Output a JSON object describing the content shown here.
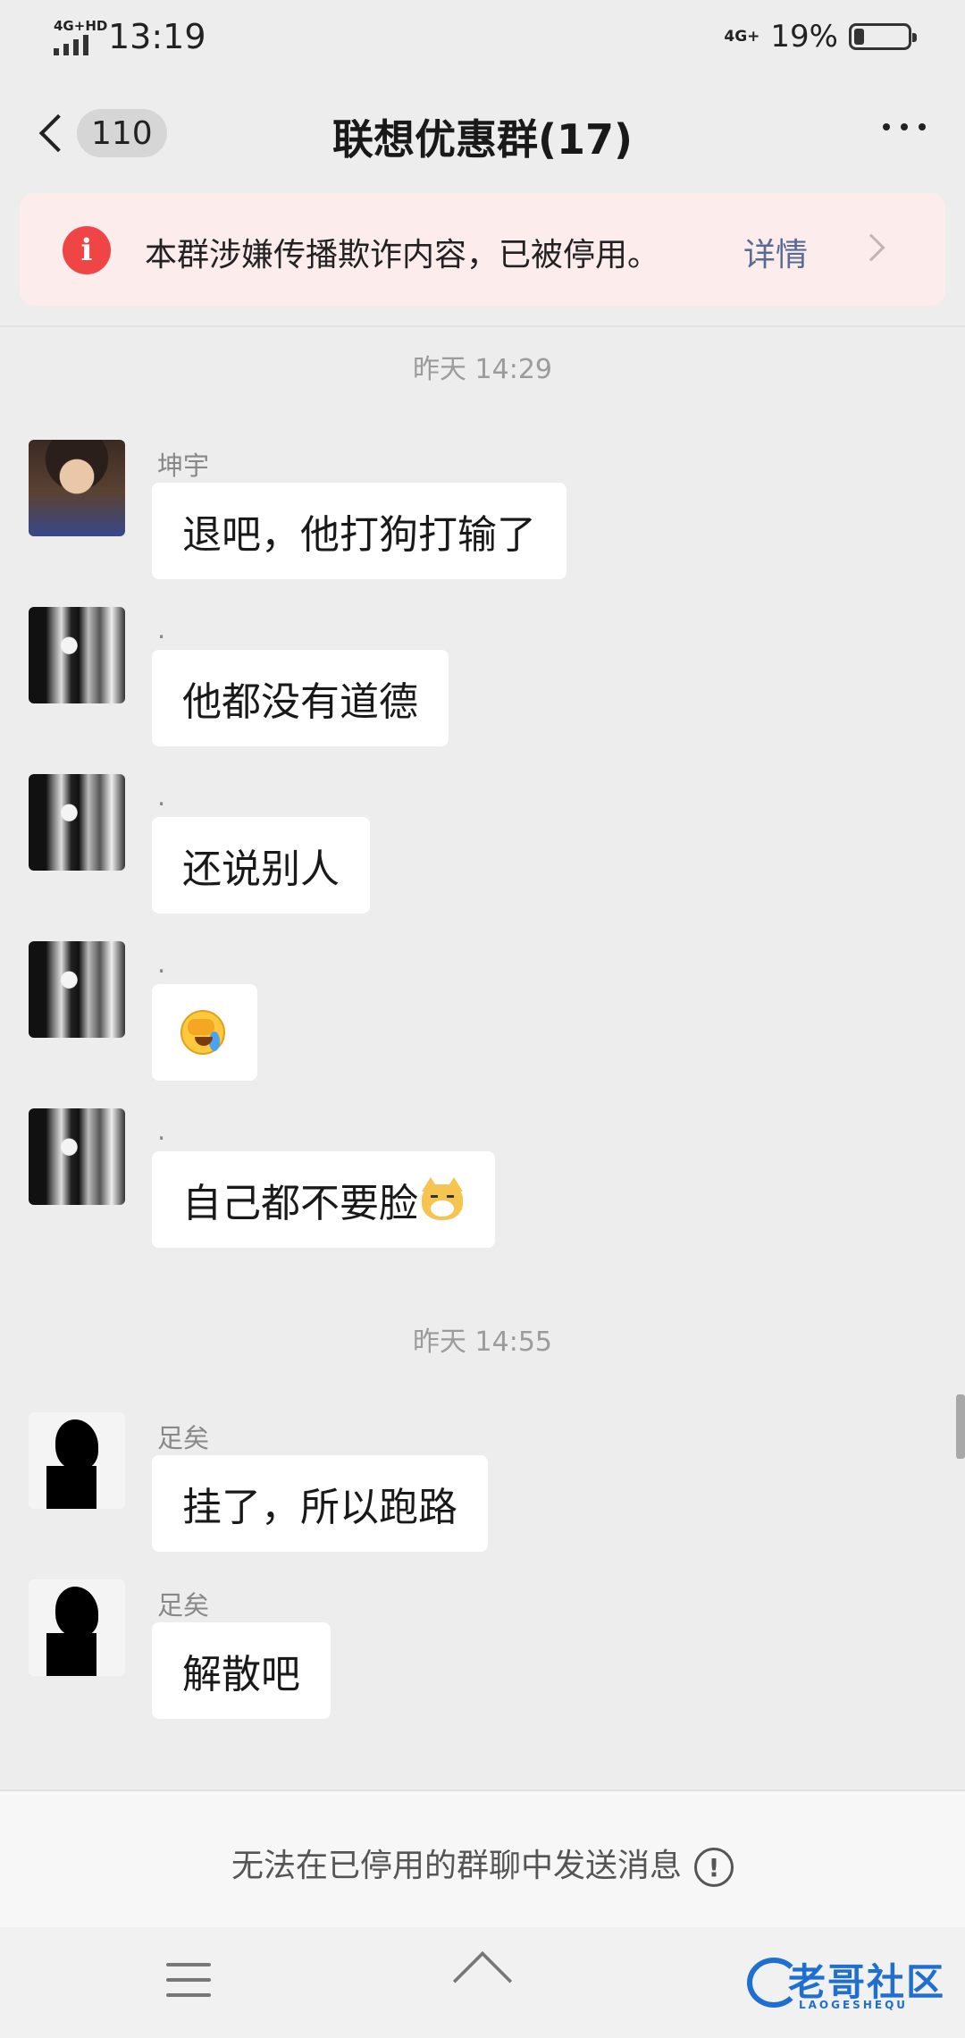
{
  "status_bar": {
    "network_left": "4G+HD",
    "time": "13:19",
    "network_right": "4G+",
    "battery_percent": "19%",
    "battery_level": 0.19
  },
  "header": {
    "unread_count": "110",
    "title": "联想优惠群(17)"
  },
  "banner": {
    "icon": "i",
    "text": "本群涉嫌传播欺诈内容，已被停用。",
    "detail_label": "详情"
  },
  "messages": [
    {
      "type": "time",
      "text": "昨天 14:29"
    },
    {
      "type": "msg",
      "sender": "坤宇",
      "avatar": "kid-photo",
      "text": "退吧，他打狗打输了"
    },
    {
      "type": "msg",
      "sender": ".",
      "avatar": "girl-photo",
      "text": "他都没有道德"
    },
    {
      "type": "msg",
      "sender": ".",
      "avatar": "girl-photo",
      "text": "还说别人"
    },
    {
      "type": "msg",
      "sender": ".",
      "avatar": "girl-photo",
      "text": "",
      "emoji": "facepalm-cry-emoji"
    },
    {
      "type": "msg",
      "sender": ".",
      "avatar": "girl-photo",
      "text": "自己都不要脸",
      "emoji": "dog-emoji"
    },
    {
      "type": "time",
      "text": "昨天 14:55"
    },
    {
      "type": "msg",
      "sender": "足矣",
      "avatar": "silhouette",
      "text": "挂了，所以跑路"
    },
    {
      "type": "msg",
      "sender": "足矣",
      "avatar": "silhouette",
      "text": "解散吧"
    }
  ],
  "bottom": {
    "disabled_text": "无法在已停用的群聊中发送消息",
    "info_icon": "!"
  },
  "watermark": {
    "text": "老哥社区",
    "sub": "LAOGESHEQU"
  },
  "colors": {
    "background": "#ededed",
    "bubble": "#ffffff",
    "banner_bg": "#fcecec",
    "warn_red": "#f04545",
    "link_blue": "#576b95"
  }
}
